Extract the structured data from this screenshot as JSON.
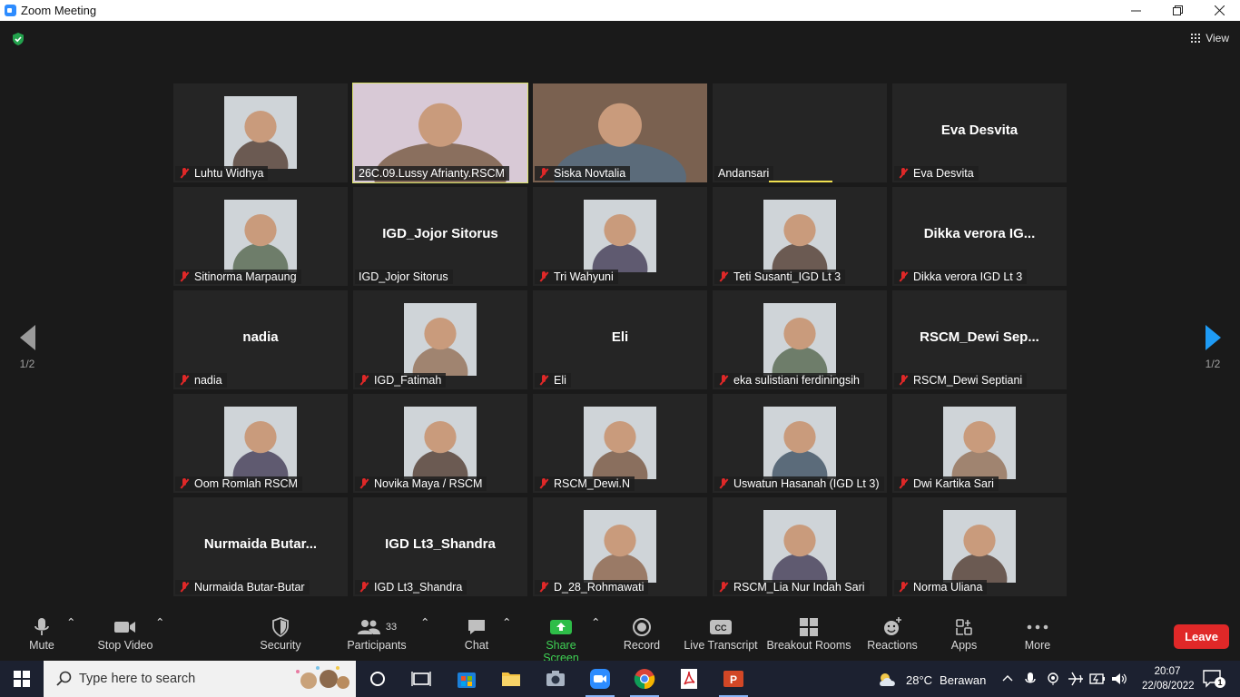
{
  "window": {
    "title": "Zoom Meeting",
    "controls": [
      "minimize",
      "restore",
      "close"
    ]
  },
  "meeting": {
    "view_label": "View",
    "page_indicator_left": "1/2",
    "page_indicator_right": "1/2",
    "participants": [
      {
        "name": "Luhtu Widhya",
        "muted": true,
        "video": true
      },
      {
        "name": "26C.09.Lussy Afrianty.RSCM",
        "muted": false,
        "video": true,
        "active": true
      },
      {
        "name": "Siska Novtalia",
        "muted": true,
        "video": true
      },
      {
        "name": "Andansari",
        "muted": false,
        "video": false,
        "speaking": true
      },
      {
        "name": "Eva Desvita",
        "muted": true,
        "video": false,
        "display_name": "Eva Desvita"
      },
      {
        "name": "Sitinorma Marpaung",
        "muted": true,
        "video": true
      },
      {
        "name": "IGD_Jojor Sitorus",
        "muted": false,
        "video": false,
        "display_name": "IGD_Jojor Sitorus"
      },
      {
        "name": "Tri Wahyuni",
        "muted": true,
        "video": true
      },
      {
        "name": "Teti Susanti_IGD Lt 3",
        "muted": true,
        "video": true
      },
      {
        "name": "Dikka verora IGD Lt 3",
        "muted": true,
        "video": false,
        "display_name": "Dikka verora IG..."
      },
      {
        "name": "nadia",
        "muted": true,
        "video": false,
        "display_name": "nadia"
      },
      {
        "name": "IGD_Fatimah",
        "muted": true,
        "video": true
      },
      {
        "name": "Eli",
        "muted": true,
        "video": false,
        "display_name": "Eli"
      },
      {
        "name": "eka sulistiani ferdiningsih",
        "muted": true,
        "video": true
      },
      {
        "name": "RSCM_Dewi Septiani",
        "muted": true,
        "video": false,
        "display_name": "RSCM_Dewi Sep..."
      },
      {
        "name": "Oom Romlah RSCM",
        "muted": true,
        "video": true
      },
      {
        "name": "Novika Maya / RSCM",
        "muted": true,
        "video": true
      },
      {
        "name": "RSCM_Dewi.N",
        "muted": true,
        "video": true
      },
      {
        "name": "Uswatun Hasanah (IGD Lt 3)",
        "muted": true,
        "video": true
      },
      {
        "name": "Dwi Kartika Sari",
        "muted": true,
        "video": true
      },
      {
        "name": "Nurmaida Butar-Butar",
        "muted": true,
        "video": false,
        "display_name": "Nurmaida Butar..."
      },
      {
        "name": "IGD Lt3_Shandra",
        "muted": true,
        "video": false,
        "display_name": "IGD Lt3_Shandra"
      },
      {
        "name": "D_28_Rohmawati",
        "muted": true,
        "video": true
      },
      {
        "name": "RSCM_Lia Nur Indah Sari",
        "muted": true,
        "video": true
      },
      {
        "name": "Norma Uliana",
        "muted": true,
        "video": true
      }
    ]
  },
  "toolbar": {
    "mute": "Mute",
    "stop_video": "Stop Video",
    "security": "Security",
    "participants": "Participants",
    "participant_count": "33",
    "chat": "Chat",
    "share_screen": "Share Screen",
    "record": "Record",
    "live_transcript": "Live Transcript",
    "breakout_rooms": "Breakout Rooms",
    "reactions": "Reactions",
    "apps": "Apps",
    "more": "More",
    "leave": "Leave",
    "cc_badge": "CC"
  },
  "taskbar": {
    "search_placeholder": "Type here to search",
    "temperature": "28°C",
    "weather": "Berawan",
    "time": "20:07",
    "date": "22/08/2022",
    "notification_count": "1"
  },
  "colors": {
    "background": "#1a1a1a",
    "tile": "#252525",
    "muted_icon": "#e02828",
    "share_green": "#3ed154",
    "active_border": "#d8e06a",
    "leave_red": "#e02828",
    "taskbar": "#1c2130"
  }
}
